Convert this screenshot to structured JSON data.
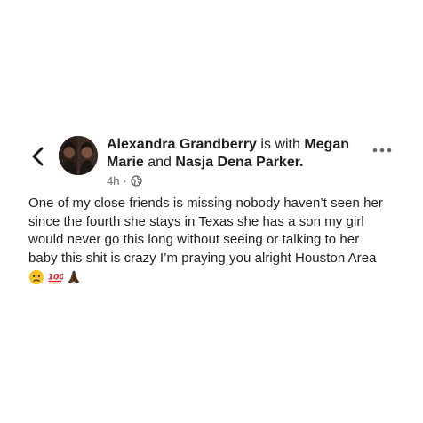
{
  "post": {
    "author": "Alexandra Grandberry",
    "with_text": "is with",
    "tagged_1": "Megan Marie",
    "and_text": "and",
    "tagged_2": "Nasja Dena Parker.",
    "timestamp": "4h",
    "separator": "·",
    "privacy_icon": "globe-icon",
    "body_line_1": "One of my close friends is missing nobody haven’t seen her",
    "body_line_2": "since the fourth she stays in Texas she has a son my girl",
    "body_line_3": "would never go this long without seeing or talking to her",
    "body_line_4": "baby this shit is crazy I’m praying you alright  Houston Area",
    "emojis": [
      "crying-face",
      "hundred-points",
      "folded-hands"
    ]
  },
  "nav": {
    "back_icon": "chevron-left-icon",
    "more_icon": "more-options-icon"
  },
  "colors": {
    "text": "#1c1e21",
    "meta": "#65676b",
    "background": "#ffffff"
  }
}
